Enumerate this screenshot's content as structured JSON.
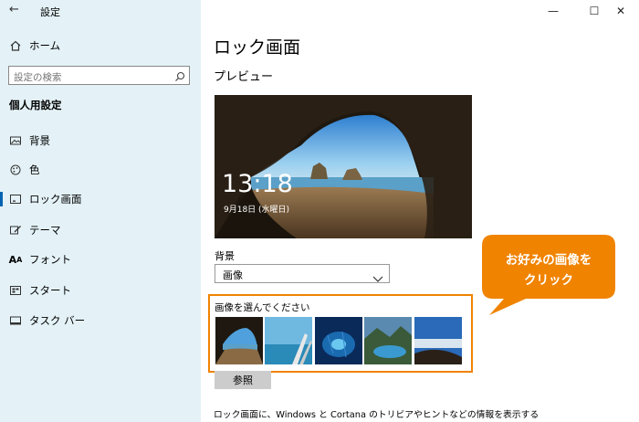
{
  "window": {
    "title": "設定",
    "min": "—",
    "max": "☐",
    "close": "✕"
  },
  "sidebar": {
    "home": "ホーム",
    "search_placeholder": "設定の検索",
    "section": "個人用設定",
    "items": [
      {
        "label": "背景",
        "icon": "picture-icon"
      },
      {
        "label": "色",
        "icon": "palette-icon"
      },
      {
        "label": "ロック画面",
        "icon": "lock-screen-icon",
        "selected": true
      },
      {
        "label": "テーマ",
        "icon": "theme-icon"
      },
      {
        "label": "フォント",
        "icon": "font-icon"
      },
      {
        "label": "スタート",
        "icon": "start-icon"
      },
      {
        "label": "タスク バー",
        "icon": "taskbar-icon"
      }
    ]
  },
  "main": {
    "title": "ロック画面",
    "preview_heading": "プレビュー",
    "preview_time": "13:18",
    "preview_date": "9月18日 (水曜日)",
    "background_label": "背景",
    "background_value": "画像",
    "choose_label": "画像を選んでください",
    "browse_button": "参照",
    "bottom_text": "ロック画面に、Windows と Cortana のトリビアやヒントなどの情報を表示する"
  },
  "callout": {
    "line1": "お好みの画像を",
    "line2": "クリック"
  },
  "colors": {
    "sidebar_bg": "#e4f2f7",
    "accent": "#0063b1",
    "callout": "#f08300",
    "highlight_border": "#f08300"
  }
}
